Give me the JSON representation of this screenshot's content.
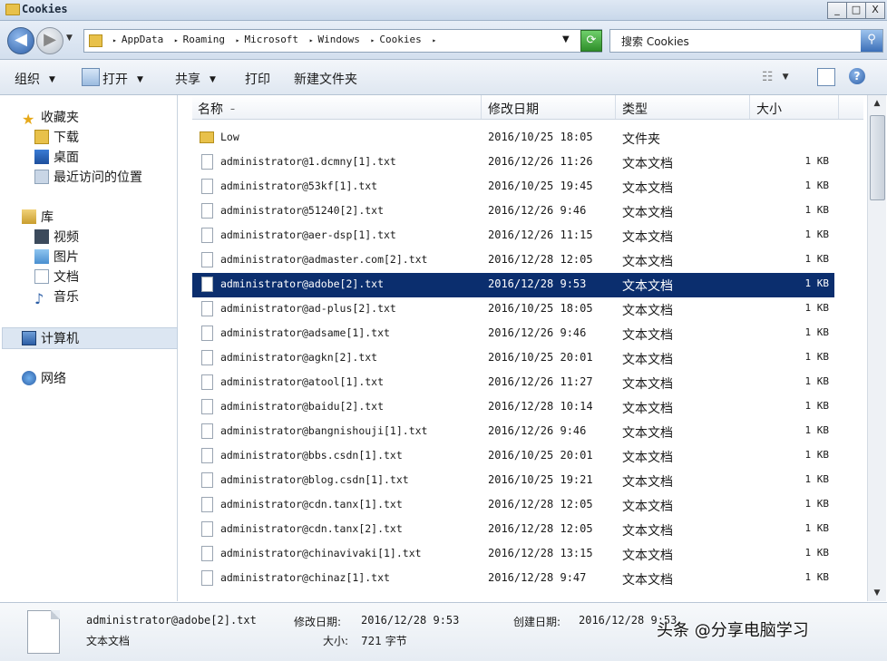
{
  "window": {
    "title": "Cookies",
    "minimize": "_",
    "maximize": "□",
    "close": "X"
  },
  "address": {
    "crumbs": [
      "AppData",
      "Roaming",
      "Microsoft",
      "Windows",
      "Cookies"
    ],
    "search_placeholder": "搜索 Cookies"
  },
  "toolbar": {
    "organize": "组织",
    "open": "打开",
    "share": "共享",
    "print": "打印",
    "new_folder": "新建文件夹"
  },
  "nav": {
    "favorites": "收藏夹",
    "downloads": "下载",
    "desktop": "桌面",
    "recent": "最近访问的位置",
    "libraries": "库",
    "videos": "视频",
    "pictures": "图片",
    "documents": "文档",
    "music": "音乐",
    "computer": "计算机",
    "network": "网络"
  },
  "columns": {
    "name": "名称",
    "date": "修改日期",
    "type": "类型",
    "size": "大小"
  },
  "files": [
    {
      "name": "Low",
      "date": "2016/10/25 18:05",
      "type": "文件夹",
      "size": "",
      "folder": true
    },
    {
      "name": "administrator@1.dcmny[1].txt",
      "date": "2016/12/26 11:26",
      "type": "文本文档",
      "size": "1 KB"
    },
    {
      "name": "administrator@53kf[1].txt",
      "date": "2016/10/25 19:45",
      "type": "文本文档",
      "size": "1 KB"
    },
    {
      "name": "administrator@51240[2].txt",
      "date": "2016/12/26 9:46",
      "type": "文本文档",
      "size": "1 KB"
    },
    {
      "name": "administrator@aer-dsp[1].txt",
      "date": "2016/12/26 11:15",
      "type": "文本文档",
      "size": "1 KB"
    },
    {
      "name": "administrator@admaster.com[2].txt",
      "date": "2016/12/28 12:05",
      "type": "文本文档",
      "size": "1 KB"
    },
    {
      "name": "administrator@adobe[2].txt",
      "date": "2016/12/28 9:53",
      "type": "文本文档",
      "size": "1 KB",
      "selected": true
    },
    {
      "name": "administrator@ad-plus[2].txt",
      "date": "2016/10/25 18:05",
      "type": "文本文档",
      "size": "1 KB"
    },
    {
      "name": "administrator@adsame[1].txt",
      "date": "2016/12/26 9:46",
      "type": "文本文档",
      "size": "1 KB"
    },
    {
      "name": "administrator@agkn[2].txt",
      "date": "2016/10/25 20:01",
      "type": "文本文档",
      "size": "1 KB"
    },
    {
      "name": "administrator@atool[1].txt",
      "date": "2016/12/26 11:27",
      "type": "文本文档",
      "size": "1 KB"
    },
    {
      "name": "administrator@baidu[2].txt",
      "date": "2016/12/28 10:14",
      "type": "文本文档",
      "size": "1 KB"
    },
    {
      "name": "administrator@bangnishouji[1].txt",
      "date": "2016/12/26 9:46",
      "type": "文本文档",
      "size": "1 KB"
    },
    {
      "name": "administrator@bbs.csdn[1].txt",
      "date": "2016/10/25 20:01",
      "type": "文本文档",
      "size": "1 KB"
    },
    {
      "name": "administrator@blog.csdn[1].txt",
      "date": "2016/10/25 19:21",
      "type": "文本文档",
      "size": "1 KB"
    },
    {
      "name": "administrator@cdn.tanx[1].txt",
      "date": "2016/12/28 12:05",
      "type": "文本文档",
      "size": "1 KB"
    },
    {
      "name": "administrator@cdn.tanx[2].txt",
      "date": "2016/12/28 12:05",
      "type": "文本文档",
      "size": "1 KB"
    },
    {
      "name": "administrator@chinavivaki[1].txt",
      "date": "2016/12/28 13:15",
      "type": "文本文档",
      "size": "1 KB"
    },
    {
      "name": "administrator@chinaz[1].txt",
      "date": "2016/12/28 9:47",
      "type": "文本文档",
      "size": "1 KB"
    }
  ],
  "details": {
    "filename": "administrator@adobe[2].txt",
    "filetype": "文本文档",
    "modified_label": "修改日期:",
    "modified_value": "2016/12/28 9:53",
    "size_label": "大小:",
    "size_value": "721 字节",
    "created_label": "创建日期:",
    "created_value": "2016/12/28 9:53"
  },
  "watermark": "头条 @分享电脑学习"
}
